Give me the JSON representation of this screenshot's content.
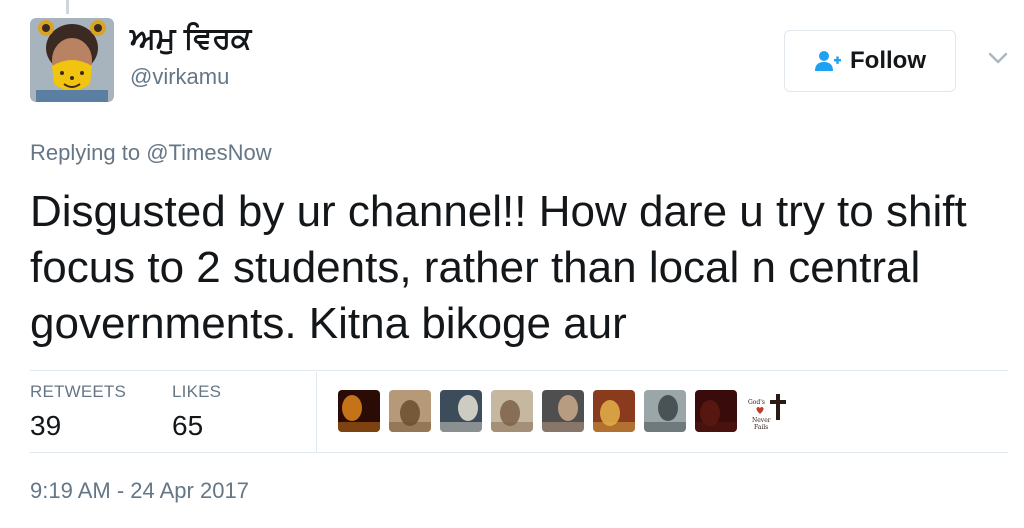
{
  "author": {
    "display_name": "ਅਮੁ ਵਿਰਕ",
    "handle": "@virkamu",
    "avatar_icon": "avatar-mask-photo"
  },
  "follow_button": {
    "label": "Follow",
    "icon": "follow-user-plus-icon"
  },
  "menu_caret_icon": "chevron-down-icon",
  "replying": {
    "prefix": "Replying to ",
    "mention": "@TimesNow"
  },
  "tweet": {
    "text": "Disgusted by ur channel!! How dare u try to shift focus to 2 students, rather than local n central governments. Kitna bikoge aur"
  },
  "stats": {
    "retweets_label": "RETWEETS",
    "retweets_count": "39",
    "likes_label": "LIKES",
    "likes_count": "65"
  },
  "likers": [
    {
      "name": "liker-flash-logo",
      "bg": "#2b0b06",
      "accent": "#e0861d"
    },
    {
      "name": "liker-outdoor",
      "bg": "#b59978",
      "accent": "#6a4e2e"
    },
    {
      "name": "liker-suit",
      "bg": "#3c4c5a",
      "accent": "#e8e2d6"
    },
    {
      "name": "liker-temple",
      "bg": "#c5b7a0",
      "accent": "#7c6246"
    },
    {
      "name": "liker-portrait",
      "bg": "#4f4f4f",
      "accent": "#c9a98b"
    },
    {
      "name": "liker-deity",
      "bg": "#8a3b1e",
      "accent": "#e3b24a"
    },
    {
      "name": "liker-landscape",
      "bg": "#9aa6a8",
      "accent": "#3b4448"
    },
    {
      "name": "liker-dark",
      "bg": "#3a0b0b",
      "accent": "#5a1a12"
    },
    {
      "name": "liker-gods-love",
      "bg": "#ffffff",
      "accent": "#2b1a12",
      "logo_text": "God's Love Never Fails"
    }
  ],
  "timestamp": "9:19 AM - 24 Apr 2017",
  "colors": {
    "text": "#14171a",
    "muted": "#657786",
    "border": "#e1e8ed",
    "follow_blue": "#1da1f2"
  }
}
